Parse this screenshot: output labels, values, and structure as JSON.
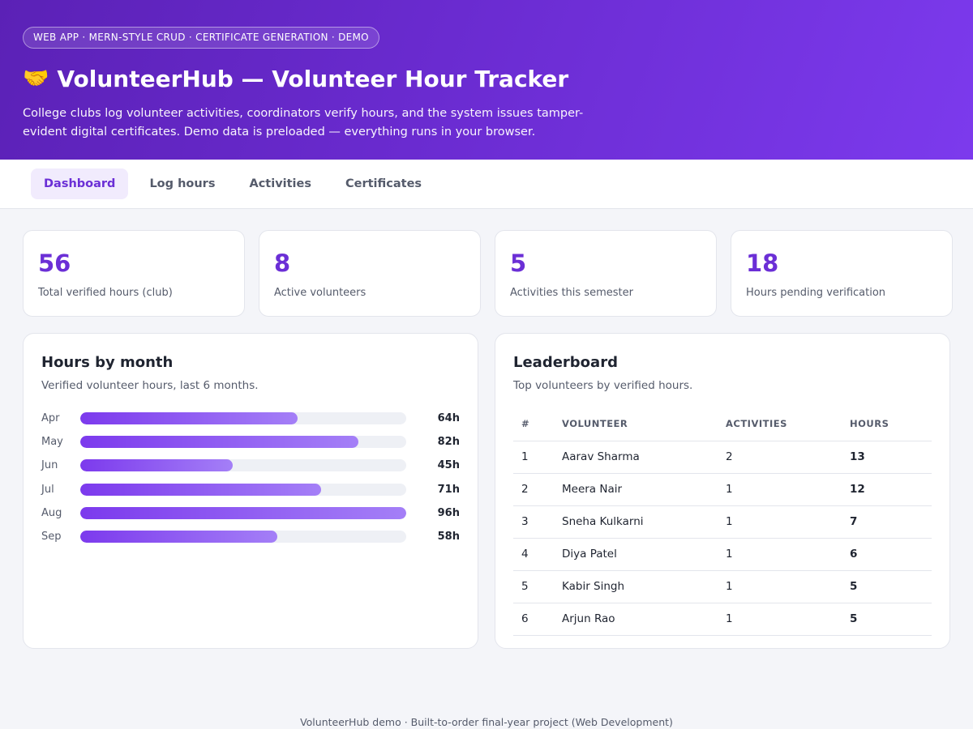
{
  "hero": {
    "badge": "WEB APP · MERN-STYLE CRUD · CERTIFICATE GENERATION · DEMO",
    "icon": "🤝",
    "title": "VolunteerHub — Volunteer Hour Tracker",
    "description": "College clubs log volunteer activities, coordinators verify hours, and the system issues tamper-evident digital certificates. Demo data is preloaded — everything runs in your browser."
  },
  "tabs": [
    {
      "label": "Dashboard",
      "active": true
    },
    {
      "label": "Log hours",
      "active": false
    },
    {
      "label": "Activities",
      "active": false
    },
    {
      "label": "Certificates",
      "active": false
    }
  ],
  "stats": [
    {
      "value": "56",
      "label": "Total verified hours (club)"
    },
    {
      "value": "8",
      "label": "Active volunteers"
    },
    {
      "value": "5",
      "label": "Activities this semester"
    },
    {
      "value": "18",
      "label": "Hours pending verification"
    }
  ],
  "hours_card": {
    "title": "Hours by month",
    "subtitle": "Verified volunteer hours, last 6 months."
  },
  "chart_data": {
    "type": "bar",
    "orientation": "horizontal",
    "categories": [
      "Apr",
      "May",
      "Jun",
      "Jul",
      "Aug",
      "Sep"
    ],
    "values": [
      64,
      82,
      45,
      71,
      96,
      58
    ],
    "value_labels": [
      "64h",
      "82h",
      "45h",
      "71h",
      "96h",
      "58h"
    ],
    "xlim": [
      0,
      96
    ],
    "title": "Hours by month",
    "subtitle": "Verified volunteer hours, last 6 months.",
    "colors": {
      "bar_start": "#7c3aed",
      "bar_end": "#a47ff7",
      "track": "#eef0f5"
    }
  },
  "leaderboard": {
    "title": "Leaderboard",
    "subtitle": "Top volunteers by verified hours.",
    "columns": [
      "#",
      "VOLUNTEER",
      "ACTIVITIES",
      "HOURS"
    ],
    "rows": [
      [
        "1",
        "Aarav Sharma",
        "2",
        "13"
      ],
      [
        "2",
        "Meera Nair",
        "1",
        "12"
      ],
      [
        "3",
        "Sneha Kulkarni",
        "1",
        "7"
      ],
      [
        "4",
        "Diya Patel",
        "1",
        "6"
      ],
      [
        "5",
        "Kabir Singh",
        "1",
        "5"
      ],
      [
        "6",
        "Arjun Rao",
        "1",
        "5"
      ]
    ]
  },
  "footer": "VolunteerHub demo · Built-to-order final-year project (Web Development)",
  "colors": {
    "accent": "#6b2fd6",
    "hero_start": "#5b21b6",
    "hero_end": "#7c3aed"
  }
}
